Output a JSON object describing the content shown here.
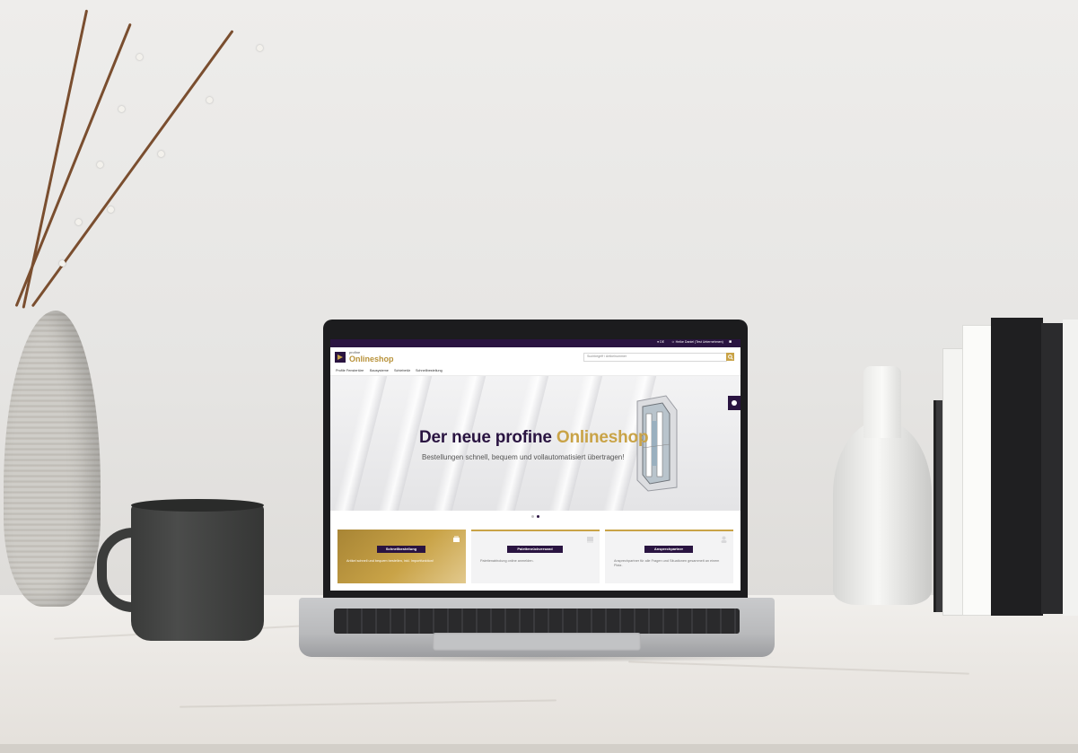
{
  "topbar": {
    "lang": "DE",
    "user": "Heike Daniel (Test Unternehmen)"
  },
  "header": {
    "brand_small": "profine",
    "brand_name": "Onlineshop",
    "search_placeholder": "Suchbegriff / Artikelnummer"
  },
  "nav": {
    "items": [
      {
        "label": "Profile Fenstertüre"
      },
      {
        "label": "Bausysteme"
      },
      {
        "label": "Schiebetür"
      },
      {
        "label": "Schnellbestellung"
      }
    ]
  },
  "hero": {
    "title_part1": "Der neue profine ",
    "title_part2": "Onlineshop",
    "subtitle": "Bestellungen schnell, bequem und vollautomatisiert übertragen!",
    "slides_count": 2,
    "active_slide": 2
  },
  "cards": [
    {
      "button": "Schnellbestellung",
      "description": "Artikel schnell und bequem bestellen, inkl. Importfunktion!",
      "icon": "card-stack-icon"
    },
    {
      "button": "Palettenrückversand",
      "description": "Palettenabholung online anmelden.",
      "icon": "pallet-icon"
    },
    {
      "button": "Ansprechpartner",
      "description": "Ansprechpartner für alle Fragen und Situationen gesammelt an einem Platz.",
      "icon": "contact-person-icon"
    }
  ],
  "colors": {
    "brand_purple": "#2a1441",
    "brand_gold": "#c9a347"
  }
}
